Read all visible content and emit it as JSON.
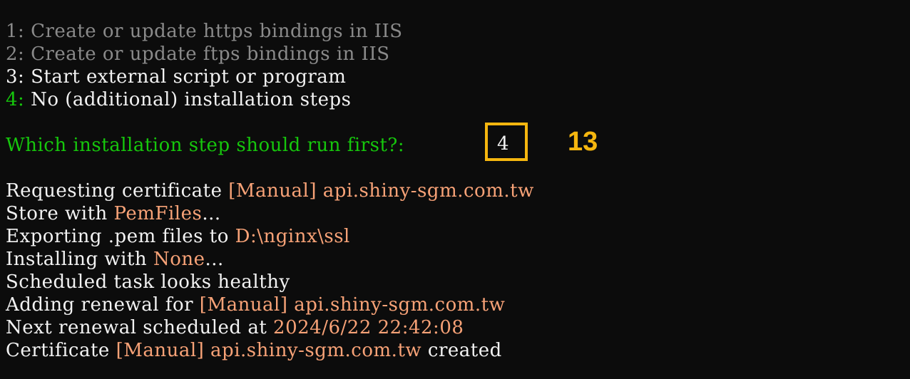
{
  "menu": {
    "option1": {
      "key": "1:",
      "text": " Create or update https bindings in IIS"
    },
    "option2": {
      "key": "2:",
      "text": " Create or update ftps bindings in IIS"
    },
    "option3": {
      "key": "3:",
      "text": " Start external script or program"
    },
    "option4": {
      "key": "4:",
      "text": " No (additional) installation steps"
    }
  },
  "prompt": {
    "question": "Which installation step should run first?:",
    "answer": "4"
  },
  "annotation": {
    "step_number": "13"
  },
  "log": {
    "l1": {
      "a": "Requesting certificate ",
      "b": "[Manual] api.shiny-sgm.com.tw"
    },
    "l2": {
      "a": "Store with ",
      "b": "PemFiles",
      "c": "..."
    },
    "l3": {
      "a": "Exporting .pem files to ",
      "b": "D:\\nginx\\ssl"
    },
    "l4": {
      "a": "Installing with ",
      "b": "None",
      "c": "..."
    },
    "l5": {
      "a": "Scheduled task looks healthy"
    },
    "l6": {
      "a": "Adding renewal for ",
      "b": "[Manual] api.shiny-sgm.com.tw"
    },
    "l7": {
      "a": "Next renewal scheduled at ",
      "b": "2024/6/22 22:42:08"
    },
    "l8": {
      "a": "Certificate ",
      "b": "[Manual] api.shiny-sgm.com.tw",
      "c": " created"
    }
  },
  "colors": {
    "background": "#0c0c0c",
    "text_default": "#f2f2f2",
    "text_dim": "#8a8a8a",
    "text_green": "#16c60c",
    "text_orange": "#f7a277",
    "highlight": "#f5b60f"
  }
}
